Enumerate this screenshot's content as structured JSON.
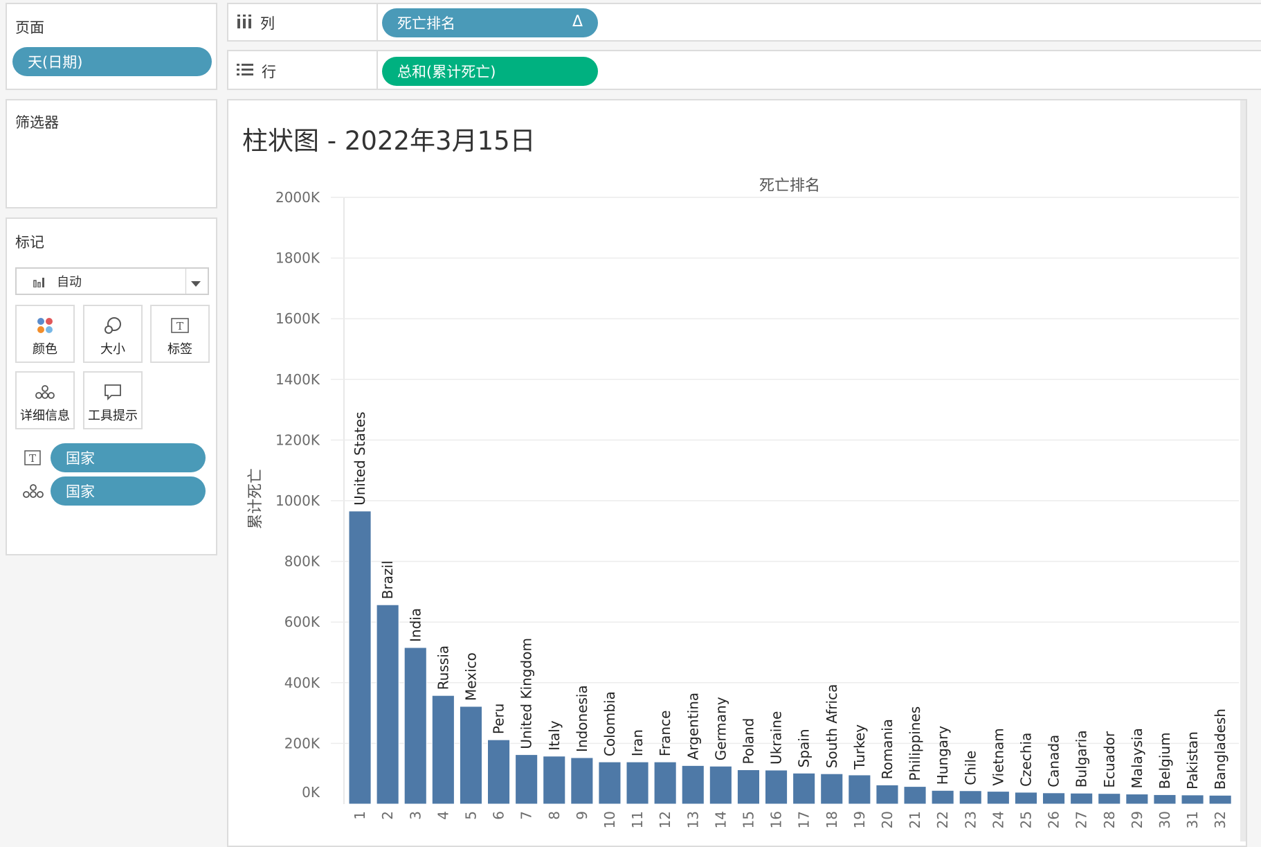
{
  "pages_shelf": {
    "title": "页面",
    "pill": "天(日期)"
  },
  "filters_shelf": {
    "title": "筛选器"
  },
  "marks": {
    "title": "标记",
    "mark_type": "自动",
    "cards": {
      "color": "颜色",
      "size": "大小",
      "label": "标签",
      "detail": "详细信息",
      "tooltip": "工具提示"
    },
    "fields": [
      {
        "icon": "label-icon",
        "name": "国家"
      },
      {
        "icon": "detail-icon",
        "name": "国家"
      }
    ]
  },
  "columns_shelf": {
    "label": "列",
    "pill": "死亡排名",
    "pill_marker": "Δ"
  },
  "rows_shelf": {
    "label": "行",
    "pill": "总和(累计死亡)"
  },
  "colors": {
    "bar": "#4e79a7",
    "pill_blue": "#4a9ab8",
    "pill_green": "#00b180"
  },
  "chart_data": {
    "type": "bar",
    "title": "柱状图 - 2022年3月15日",
    "header_label": "死亡排名",
    "ylabel": "累计死亡",
    "ylim": [
      0,
      2000000
    ],
    "ytick_labels": [
      "0K",
      "200K",
      "400K",
      "600K",
      "800K",
      "1000K",
      "1200K",
      "1400K",
      "1600K",
      "1800K",
      "2000K"
    ],
    "categories": [
      "1",
      "2",
      "3",
      "4",
      "5",
      "6",
      "7",
      "8",
      "9",
      "10",
      "11",
      "12",
      "13",
      "14",
      "15",
      "16",
      "17",
      "18",
      "19",
      "20",
      "21",
      "22",
      "23",
      "24",
      "25",
      "26",
      "27",
      "28",
      "29",
      "30",
      "31",
      "32"
    ],
    "bar_labels": [
      "United States",
      "Brazil",
      "India",
      "Russia",
      "Mexico",
      "Peru",
      "United Kingdom",
      "Italy",
      "Indonesia",
      "Colombia",
      "Iran",
      "France",
      "Argentina",
      "Germany",
      "Poland",
      "Ukraine",
      "Spain",
      "South Africa",
      "Turkey",
      "Romania",
      "Philippines",
      "Hungary",
      "Chile",
      "Vietnam",
      "Czechia",
      "Canada",
      "Bulgaria",
      "Ecuador",
      "Malaysia",
      "Belgium",
      "Pakistan",
      "Bangladesh"
    ],
    "values": [
      966000,
      657000,
      516000,
      358000,
      322000,
      212000,
      163000,
      158000,
      153000,
      139000,
      139000,
      139000,
      127000,
      125000,
      113000,
      112000,
      102000,
      100000,
      96000,
      63000,
      58000,
      45000,
      44000,
      42000,
      39000,
      37000,
      36000,
      35000,
      33000,
      31000,
      30000,
      29000
    ],
    "grid": true,
    "legend": "none"
  }
}
